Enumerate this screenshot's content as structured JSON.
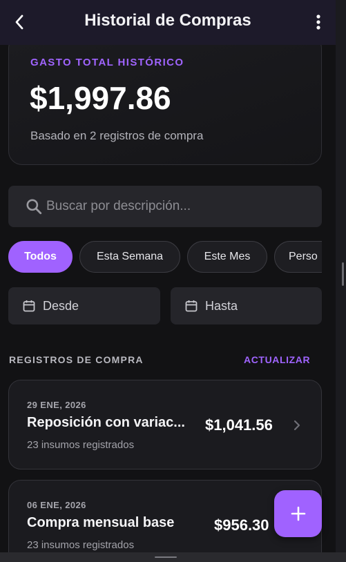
{
  "header": {
    "title": "Historial de Compras",
    "back_icon": "chevron-left-icon",
    "menu_icon": "more-vertical-icon"
  },
  "summary": {
    "label": "GASTO TOTAL HISTÓRICO",
    "amount": "$1,997.86",
    "subtitle": "Basado en 2 registros de compra"
  },
  "search": {
    "placeholder": "Buscar por descripción...",
    "value": "",
    "icon": "search-icon"
  },
  "filters": {
    "chips": [
      {
        "label": "Todos",
        "active": true
      },
      {
        "label": "Esta Semana",
        "active": false
      },
      {
        "label": "Este Mes",
        "active": false
      },
      {
        "label": "Perso",
        "active": false
      }
    ]
  },
  "date_range": {
    "from_label": "Desde",
    "to_label": "Hasta",
    "icon": "calendar-icon"
  },
  "records": {
    "section_title": "REGISTROS DE COMPRA",
    "refresh_label": "ACTUALIZAR",
    "items": [
      {
        "date": "29 ENE, 2026",
        "name": "Reposición con variac...",
        "count": "23 insumos registrados",
        "price": "$1,041.56"
      },
      {
        "date": "06 ENE, 2026",
        "name": "Compra mensual base",
        "count": "23 insumos registrados",
        "price": "$956.30"
      }
    ]
  },
  "fab": {
    "icon": "plus-icon"
  },
  "colors": {
    "accent": "#a062ff",
    "background": "#121214",
    "appbar": "#1d1a2a",
    "card": "#1b1b1f"
  }
}
